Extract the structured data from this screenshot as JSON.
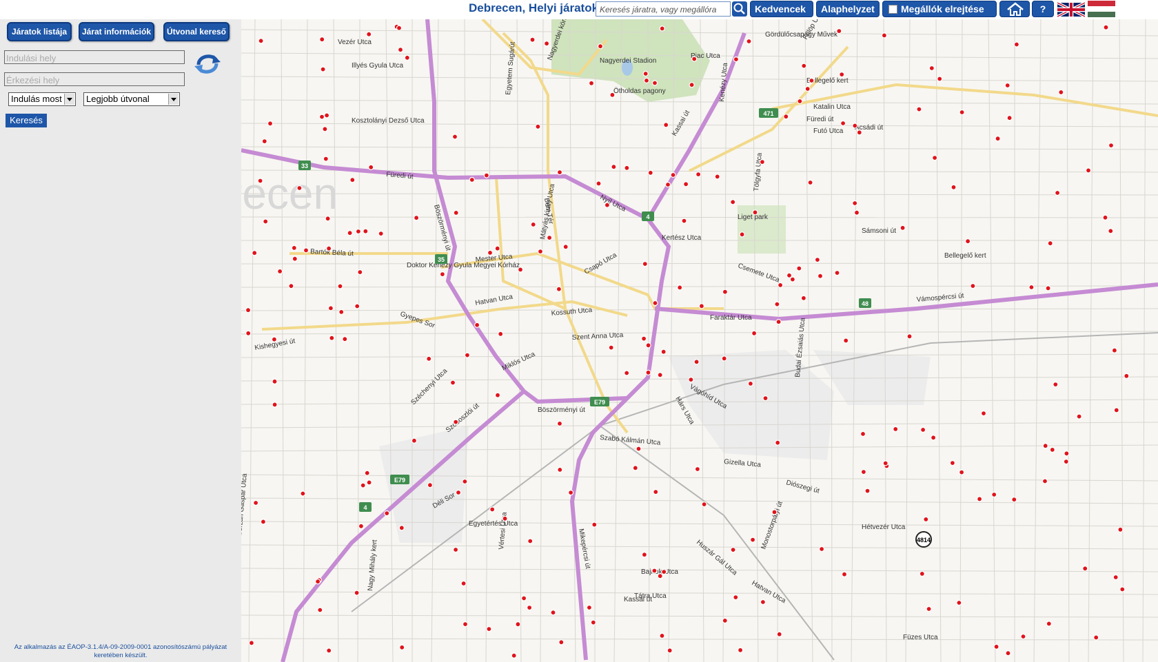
{
  "header": {
    "title": "Debrecen, Helyi járatok",
    "search_placeholder": "Keresés járatra, vagy megállóra",
    "favorites": "Kedvencek",
    "home_position": "Alaphelyzet",
    "hide_stops": "Megállók elrejtése",
    "help": "?"
  },
  "sidebar": {
    "tabs": [
      "Járatok listája",
      "Járat információk",
      "Útvonal kereső"
    ],
    "from_placeholder": "Indulási hely",
    "to_placeholder": "Érkezési hely",
    "depart_select": "Indulás most",
    "mode_select": "Legjobb útvonal",
    "search_button": "Keresés",
    "footer": "Az alkalmazás az ÉAOP-3.1.4/A-09-2009-0001 azonosítószámú pályázat keretében készült."
  },
  "map": {
    "city_watermark": "recen",
    "areas": [
      "Gördülőcsapágy Művek",
      "Nagyerdei Stadion",
      "Ötholdas pagony",
      "Liget park",
      "Doktor Kenézy Gyula Megyei Kórház",
      "Bellegelő kert"
    ],
    "roads": [
      "Füredi út",
      "Nyíl Utca",
      "Böszörményi út",
      "Kassai út",
      "Bartók Béla út",
      "Mester Utca",
      "Csapó Utca",
      "Hatvan Utca",
      "Kossuth Utca",
      "Faraktár Utca",
      "Vámospércsi út",
      "Szent Anna Utca",
      "Miklós Utca",
      "Szoboszlói út",
      "Vágóhíd Utca",
      "Szabó Kálmán Utca",
      "Gizella Utca",
      "Diószegi út",
      "Acsádi út",
      "Katalin Utca",
      "Füredi út",
      "Bem Tér",
      "Egyetem Sugárút",
      "Nagyerdei körút",
      "Vezér Utca",
      "Illyés Gyula Utca",
      "Kosztolányi Dezső Utca",
      "Kishegyesi út",
      "Széchenyi Utca",
      "Déli Sor",
      "Mikepércsi út",
      "Hatvan Utca",
      "Bajnok Utca",
      "Tátra Utca",
      "Hárs Utca",
      "Budai Ézsaiás Utca",
      "Hétvezér Utca",
      "Füzes Utca",
      "Bellegelő kert",
      "Futó Utca",
      "Fülöp Utca",
      "Sámsoni út",
      "Kertész Utca",
      "Csemete Utca",
      "Huszár Gál Utca",
      "Monostorpályi út",
      "Borzán Gáspár Utca",
      "Nagy Mihály kert",
      "Vértesi Utca",
      "Egyetértés Utca",
      "Gyepes Sor",
      "Kenézy Utca",
      "Tölgyfa Utca",
      "Mátyás király Utca",
      "Böszörményi út",
      "Kassai út",
      "Piac Utca"
    ],
    "road_shields": [
      "35",
      "471",
      "4",
      "48",
      "E79",
      "E79",
      "4",
      "4814",
      "33"
    ]
  },
  "colors": {
    "accent": "#1e56a8",
    "highway": "#c58bd3",
    "main_road": "#f2d98a",
    "stop": "#e0141c",
    "park": "#cfe3bd",
    "shield": "#3f8d4f"
  },
  "icons": {
    "search": "magnifier-icon",
    "swap": "swap-arrows-icon",
    "home": "house-icon"
  }
}
